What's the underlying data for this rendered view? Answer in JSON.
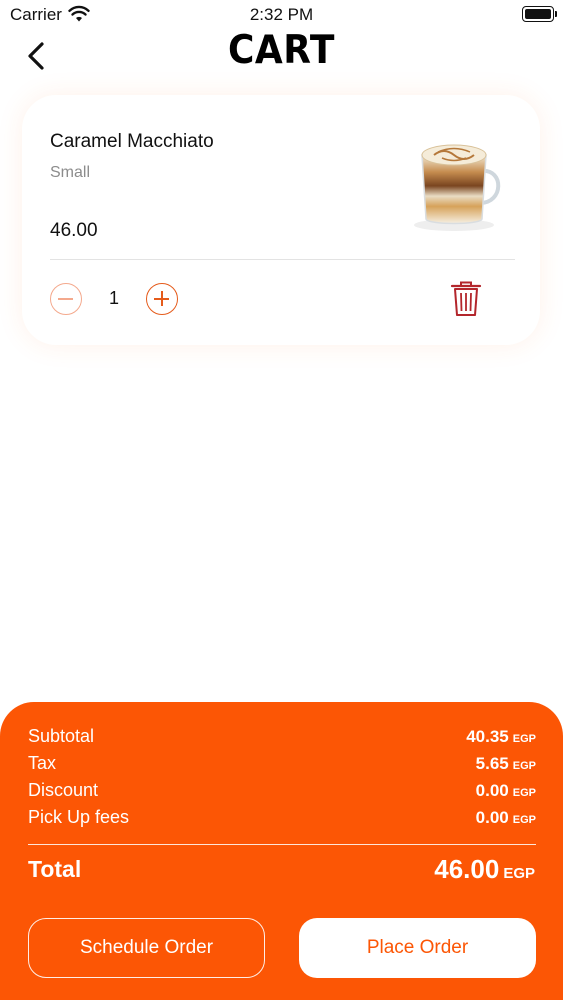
{
  "status_bar": {
    "carrier": "Carrier",
    "time": "2:32 PM",
    "icons": [
      "wifi-icon",
      "battery-icon"
    ]
  },
  "header": {
    "title": "CART",
    "back_icon": "chevron-left-icon"
  },
  "cart": {
    "items": [
      {
        "name": "Caramel Macchiato",
        "size": "Small",
        "price": "46.00",
        "quantity": "1",
        "image": "caramel-macchiato-cup-image",
        "icons": [
          "minus-circle-icon",
          "plus-circle-icon",
          "trash-icon"
        ]
      }
    ]
  },
  "summary": {
    "rows": [
      {
        "label": "Subtotal",
        "value": "40.35",
        "currency": "EGP"
      },
      {
        "label": "Tax",
        "value": "5.65",
        "currency": "EGP"
      },
      {
        "label": "Discount",
        "value": "0.00",
        "currency": "EGP"
      },
      {
        "label": "Pick Up fees",
        "value": "0.00",
        "currency": "EGP"
      }
    ],
    "total_label": "Total",
    "total_value": "46.00",
    "total_currency": "EGP"
  },
  "actions": {
    "schedule_label": "Schedule Order",
    "place_label": "Place Order"
  },
  "colors": {
    "accent": "#fc5605",
    "delete": "#b3262c",
    "muted_text": "#8c8c8c"
  }
}
